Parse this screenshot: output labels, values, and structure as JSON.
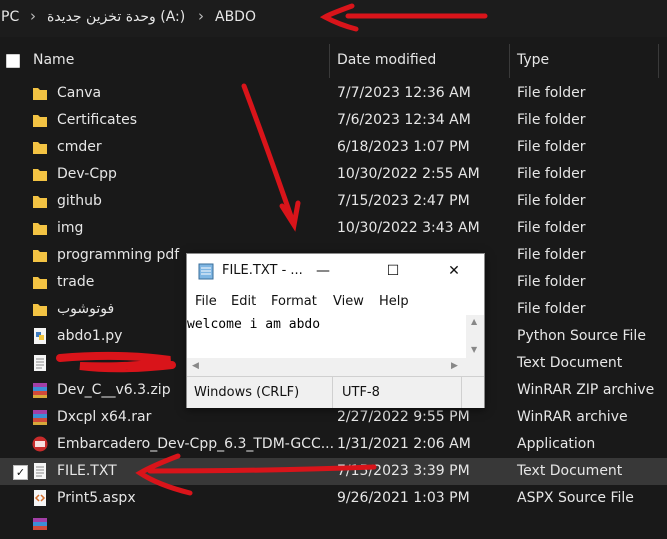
{
  "breadcrumb": [
    "PC",
    "وحدة تخزين جديدة (A:)",
    "ABDO"
  ],
  "columns": {
    "name": "Name",
    "date": "Date modified",
    "type": "Type"
  },
  "rows": [
    {
      "name": "Canva",
      "date": "7/7/2023 12:36 AM",
      "type": "File folder",
      "icon": "folder-icon"
    },
    {
      "name": "Certificates",
      "date": "7/6/2023 12:34 AM",
      "type": "File folder",
      "icon": "folder-icon"
    },
    {
      "name": "cmder",
      "date": "6/18/2023 1:07 PM",
      "type": "File folder",
      "icon": "folder-icon"
    },
    {
      "name": "Dev-Cpp",
      "date": "10/30/2022 2:55 AM",
      "type": "File folder",
      "icon": "folder-icon"
    },
    {
      "name": "github",
      "date": "7/15/2023 2:47 PM",
      "type": "File folder",
      "icon": "folder-icon"
    },
    {
      "name": "img",
      "date": "10/30/2022 3:43 AM",
      "type": "File folder",
      "icon": "folder-icon"
    },
    {
      "name": "programming pdf",
      "date": "",
      "type": "File folder",
      "icon": "folder-icon"
    },
    {
      "name": "trade",
      "date": "",
      "type": "File folder",
      "icon": "folder-icon"
    },
    {
      "name": "فوتوشوب",
      "date": "",
      "type": "File folder",
      "icon": "folder-icon"
    },
    {
      "name": "abdo1.py",
      "date": "",
      "type": "Python Source File",
      "icon": "python-file-icon"
    },
    {
      "name": "",
      "date": "",
      "type": "Text Document",
      "icon": "text-file-icon"
    },
    {
      "name": "Dev_C__v6.3.zip",
      "date": "",
      "type": "WinRAR ZIP archive",
      "icon": "winrar-icon"
    },
    {
      "name": "Dxcpl x64.rar",
      "date": "2/27/2022 9:55 PM",
      "type": "WinRAR archive",
      "icon": "winrar-icon"
    },
    {
      "name": "Embarcadero_Dev-Cpp_6.3_TDM-GCC...",
      "date": "1/31/2021 2:06 AM",
      "type": "Application",
      "icon": "devcpp-app-icon"
    },
    {
      "name": "FILE.TXT",
      "date": "7/15/2023 3:39 PM",
      "type": "Text Document",
      "icon": "text-file-icon",
      "selected": true
    },
    {
      "name": "Print5.aspx",
      "date": "9/26/2021 1:03 PM",
      "type": "ASPX Source File",
      "icon": "aspx-file-icon"
    }
  ],
  "notepad": {
    "title": "FILE.TXT - ...",
    "menu": [
      "File",
      "Edit",
      "Format",
      "View",
      "Help"
    ],
    "content": "welcome i am abdo",
    "line_ending": "Windows (CRLF)",
    "encoding": "UTF-8"
  },
  "colors": {
    "background": "#191919",
    "selected_row": "#383838",
    "annotation": "#d9141a",
    "folder": "#f3c343"
  }
}
